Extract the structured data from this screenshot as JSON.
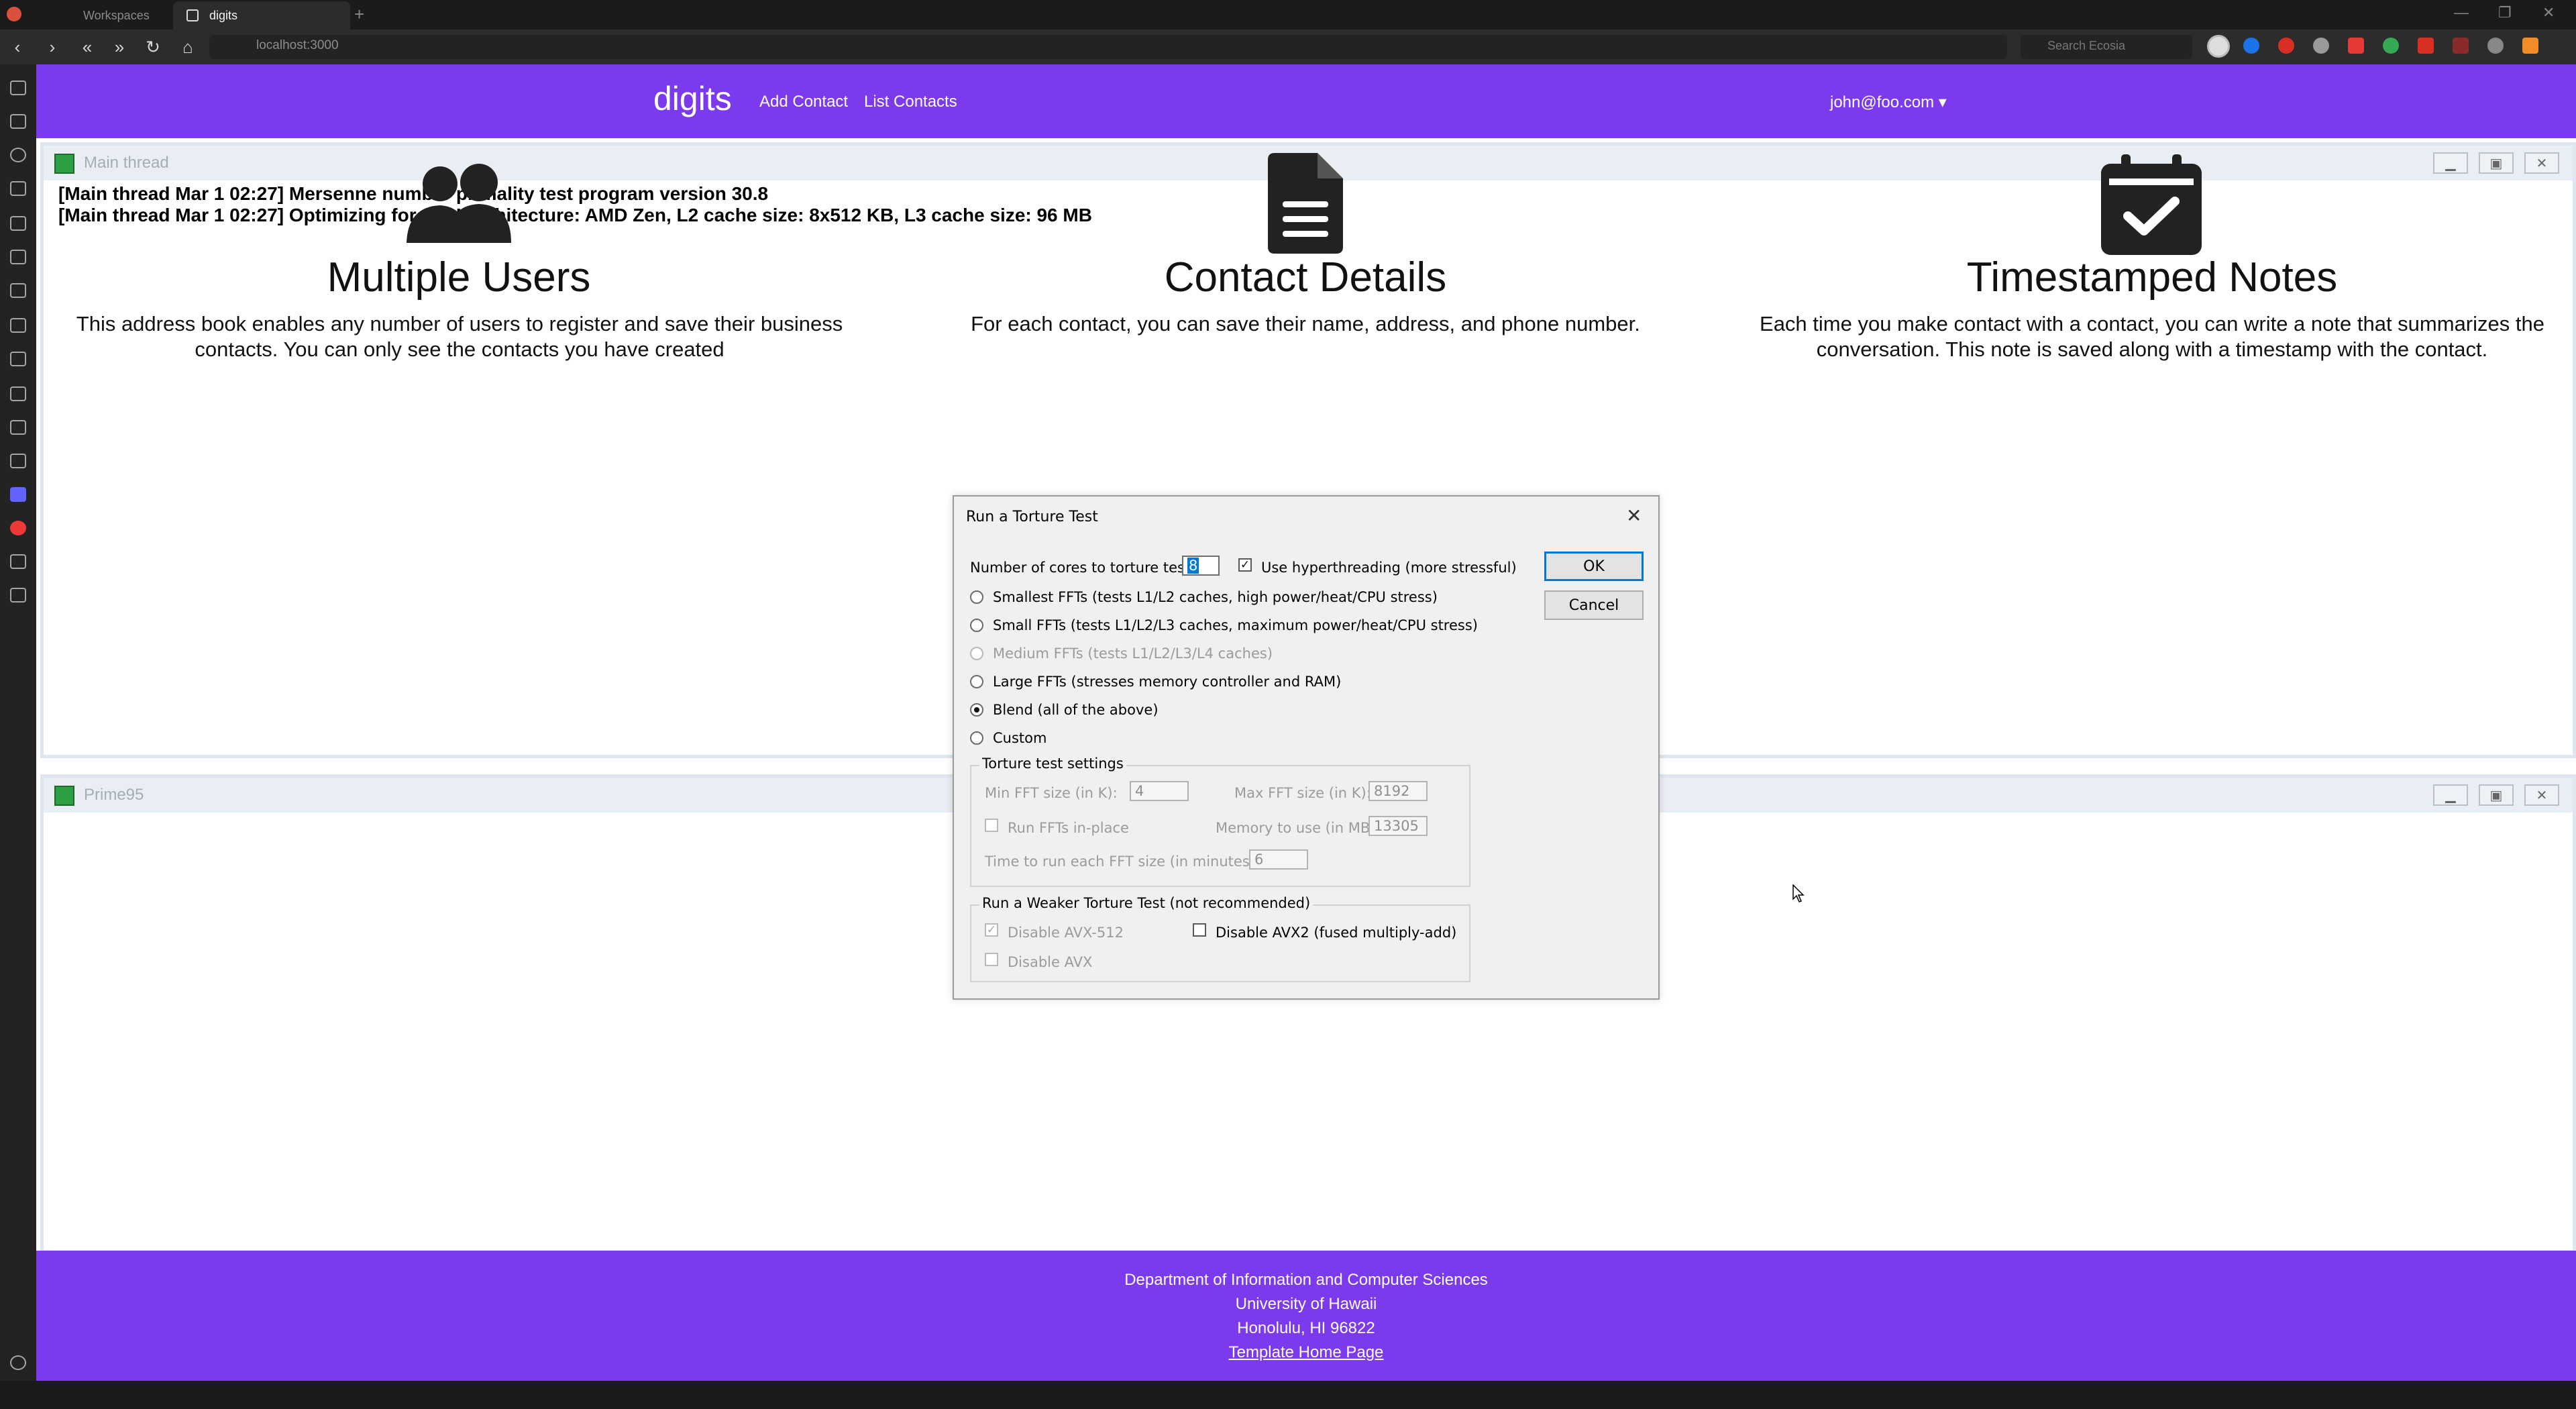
{
  "browser": {
    "tabs": [
      {
        "label": "Workspaces"
      },
      {
        "label": "digits"
      }
    ],
    "url": "localhost:3000",
    "search_placeholder": "Search Ecosia"
  },
  "site": {
    "brand": "digits",
    "nav": [
      "Add Contact",
      "List Contacts"
    ],
    "user": "john@foo.com"
  },
  "features": [
    {
      "title": "Multiple Users",
      "desc": "This address book enables any number of users to register and save their business contacts. You can only see the contacts you have created",
      "icon": "users-icon"
    },
    {
      "title": "Contact Details",
      "desc": "For each contact, you can save their name, address, and phone number.",
      "icon": "document-icon"
    },
    {
      "title": "Timestamped Notes",
      "desc": "Each time you make contact with a contact, you can write a note that summarizes the conversation. This note is saved along with a timestamp with the contact.",
      "icon": "calendar-check-icon"
    }
  ],
  "footer": {
    "lines": [
      "Department of Information and Computer Sciences",
      "University of Hawaii",
      "Honolulu, HI 96822"
    ],
    "link": "Template Home Page"
  },
  "prime95": {
    "main_thread_title": "Main thread",
    "log": [
      "[Main thread Mar 1 02:27] Mersenne number primality test program version 30.8",
      "[Main thread Mar 1 02:27] Optimizing for CPU architecture: AMD Zen, L2 cache size: 8x512 KB, L3 cache size: 96 MB"
    ],
    "window_title": "Prime95"
  },
  "dialog": {
    "title": "Run a Torture Test",
    "cores_label": "Number of cores to torture test:",
    "cores_value": "8",
    "hyperthreading_label": "Use hyperthreading (more stressful)",
    "hyperthreading_checked": true,
    "options": [
      {
        "label": "Smallest FFTs (tests L1/L2 caches, high power/heat/CPU stress)",
        "selected": false,
        "disabled": false
      },
      {
        "label": "Small FFTs (tests L1/L2/L3 caches, maximum power/heat/CPU stress)",
        "selected": false,
        "disabled": false
      },
      {
        "label": "Medium FFTs (tests L1/L2/L3/L4 caches)",
        "selected": false,
        "disabled": true
      },
      {
        "label": "Large FFTs (stresses memory controller and RAM)",
        "selected": false,
        "disabled": false
      },
      {
        "label": "Blend (all of the above)",
        "selected": true,
        "disabled": false
      },
      {
        "label": "Custom",
        "selected": false,
        "disabled": false
      }
    ],
    "settings_group": "Torture test settings",
    "min_fft_label": "Min FFT size (in K):",
    "min_fft_value": "4",
    "max_fft_label": "Max FFT size (in K):",
    "max_fft_value": "8192",
    "inplace_label": "Run FFTs in-place",
    "memory_label": "Memory to use (in MB):",
    "memory_value": "13305",
    "time_label": "Time to run each FFT size (in minutes):",
    "time_value": "6",
    "weaker_group": "Run a Weaker Torture Test (not recommended)",
    "avx512_label": "Disable AVX-512",
    "avx2_label": "Disable AVX2 (fused multiply-add)",
    "avx_label": "Disable AVX",
    "ok": "OK",
    "cancel": "Cancel"
  },
  "colors": {
    "brand": "#7c3aed",
    "dialog_bg": "#f0f0f0"
  }
}
